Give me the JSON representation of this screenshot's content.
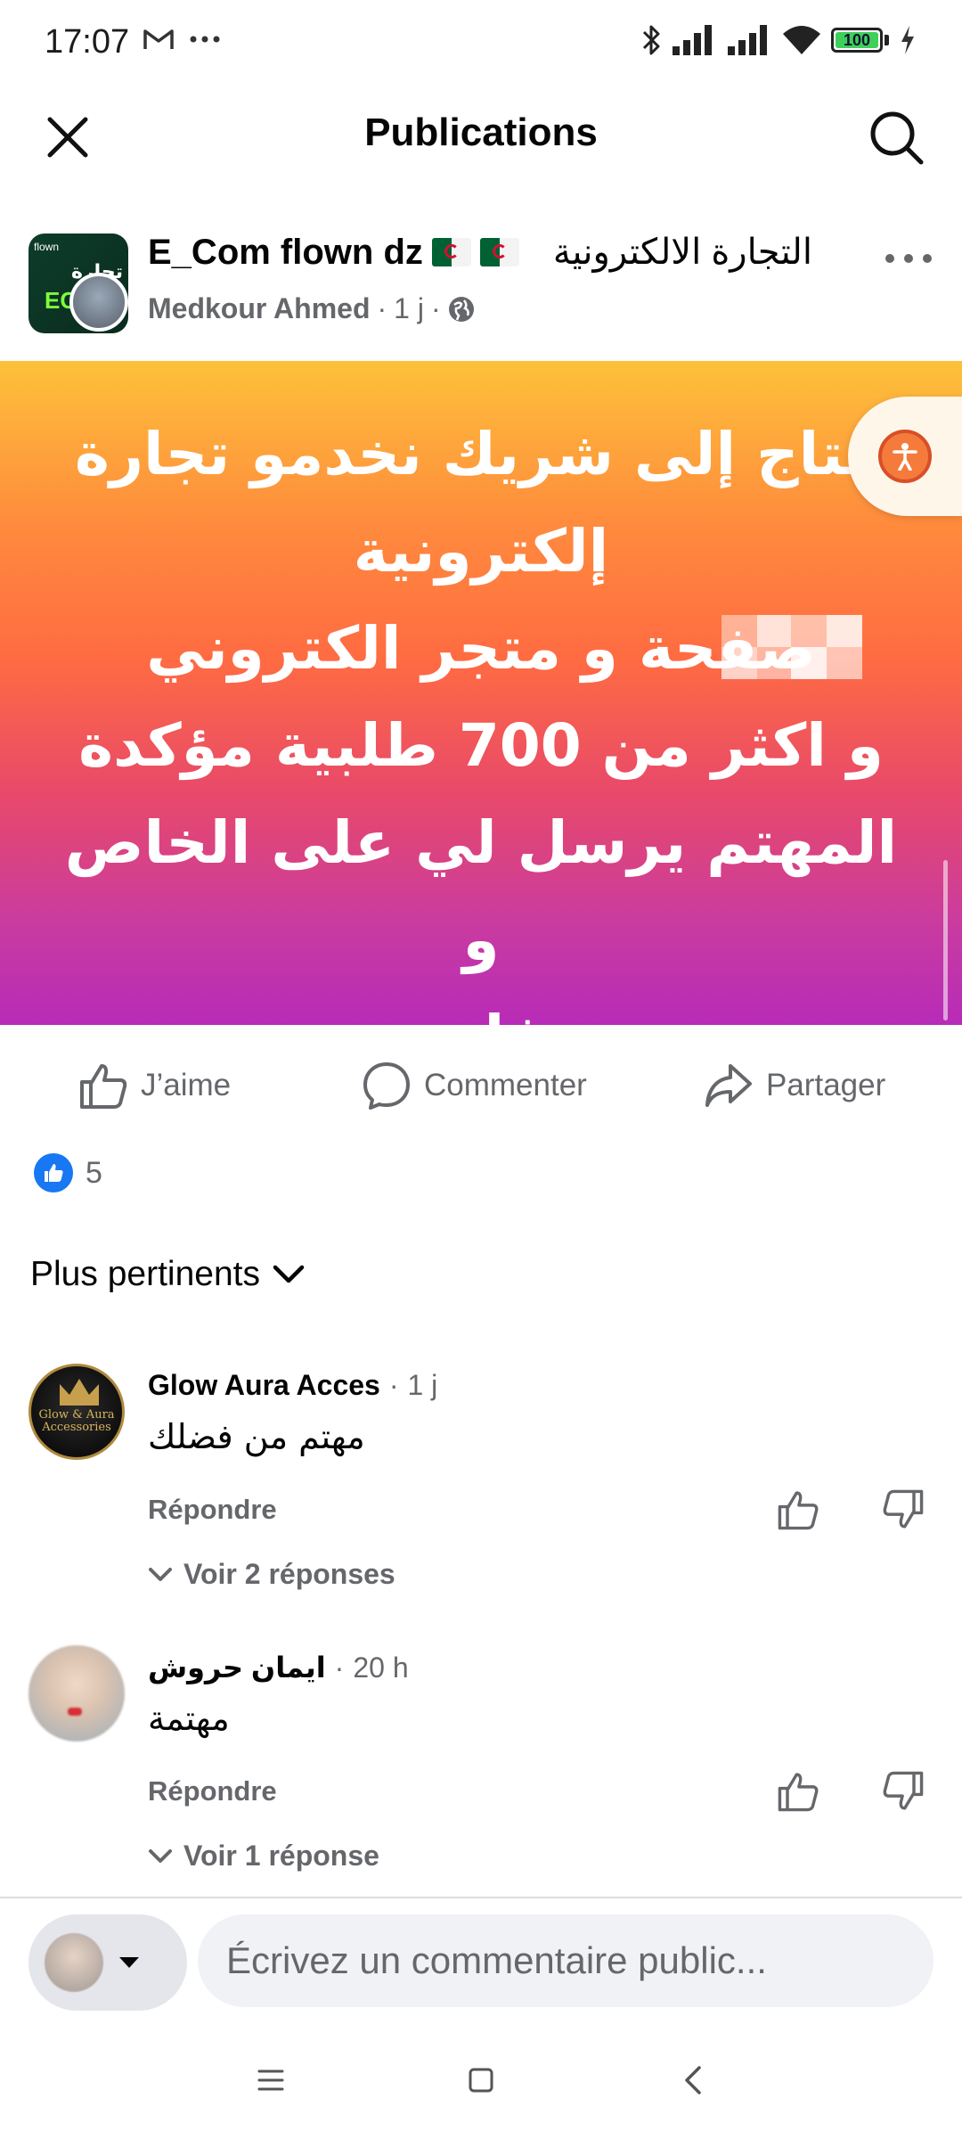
{
  "status_bar": {
    "time": "17:07",
    "battery_level": "100",
    "icons": [
      "gmail-icon",
      "more-dots-icon",
      "bluetooth-icon",
      "signal-icon",
      "signal-icon",
      "wifi-icon",
      "battery-icon",
      "charging-icon"
    ]
  },
  "header": {
    "title": "Publications",
    "close_icon": "close-icon",
    "search_icon": "search-icon"
  },
  "post": {
    "group_name": "E_Com flown dz",
    "group_name_ar": "التجارة الالكترونية",
    "author": "Medkour Ahmed",
    "time": "1 j",
    "privacy_icon": "globe-icon",
    "avatar_text": {
      "tag": "flown",
      "ec": "EC",
      "ar": "تجارة"
    },
    "image_text": "حتاج إلى شريك نخدمو تجارة\nإلكترونية\nصفحة و متجر الكتروني\nو اكثر من 700 طلبية مؤكدة\nالمهتم يرسل لي على الخاص و\nنتفاهمو",
    "actions": {
      "like": "J’aime",
      "comment": "Commenter",
      "share": "Partager"
    },
    "reaction_count": "5"
  },
  "comments_sort": {
    "label": "Plus pertinents"
  },
  "comments": [
    {
      "author": "Glow Aura Acces",
      "time": "1 j",
      "text": "مهتم من فضلك",
      "reply_label": "Répondre",
      "view_replies": "Voir 2 réponses",
      "avatar_text": "Glow & Aura\nAccessories"
    },
    {
      "author": "ايمان حروش",
      "time": "20 h",
      "text": "مهتمة",
      "reply_label": "Répondre",
      "view_replies": "Voir 1 réponse"
    }
  ],
  "composer": {
    "placeholder": "Écrivez un commentaire public..."
  },
  "nav_bar": {
    "icons": [
      "menu-icon",
      "home-square-icon",
      "back-chevron-icon"
    ]
  },
  "colors": {
    "brand_blue": "#1877f2",
    "secondary_text": "#65676b",
    "gradient_top": "#fdc13a",
    "gradient_bottom": "#b72bb8"
  }
}
